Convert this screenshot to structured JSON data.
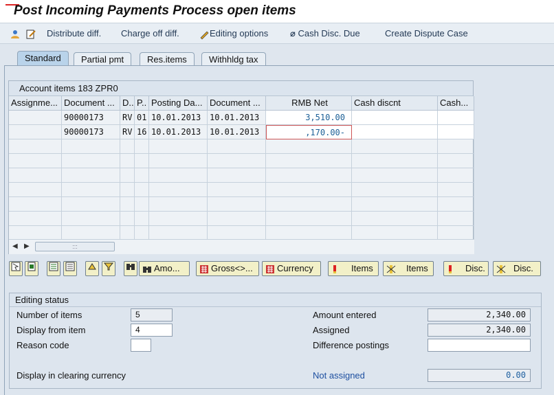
{
  "window": {
    "title": "Post Incoming Payments Process open items"
  },
  "toolbar": {
    "distribute": "Distribute diff.",
    "charge_off": "Charge off diff.",
    "editing_options": "Editing options",
    "cash_disc_due": "Cash Disc. Due",
    "create_dispute": "Create Dispute Case"
  },
  "tabs": [
    "Standard",
    "Partial pmt",
    "Res.items",
    "Withhldg tax"
  ],
  "grid": {
    "title": "Account items 183 ZPR0",
    "columns": [
      "Assignme...",
      "Document ...",
      "D..",
      "P..",
      "Posting Da...",
      "Document ...",
      "RMB Net",
      "Cash discnt",
      "Cash..."
    ],
    "rows": [
      [
        "",
        "90000173",
        "RV",
        "01",
        "10.01.2013",
        "10.01.2013",
        "3,510.00",
        "",
        ""
      ],
      [
        "",
        "90000173",
        "RV",
        "16",
        "10.01.2013",
        "10.01.2013",
        ",170.00-",
        "",
        ""
      ]
    ],
    "scroll_thumb": ":::"
  },
  "alv_toolbar": {
    "amount": "Amo...",
    "gross": "Gross<>...",
    "currency": "Currency",
    "items1": "Items",
    "items2": "Items",
    "disc1": "Disc.",
    "disc2": "Disc."
  },
  "editing_status": {
    "title": "Editing status",
    "number_of_items_label": "Number of items",
    "number_of_items": "5",
    "display_from_item_label": "Display from item",
    "display_from_item": "4",
    "reason_code_label": "Reason code",
    "reason_code": "",
    "display_clearing_label": "Display in clearing currency",
    "amount_entered_label": "Amount entered",
    "amount_entered": "2,340.00",
    "assigned_label": "Assigned",
    "assigned": "2,340.00",
    "difference_postings_label": "Difference postings",
    "difference_postings": "",
    "not_assigned_label": "Not assigned",
    "not_assigned": "0.00"
  }
}
